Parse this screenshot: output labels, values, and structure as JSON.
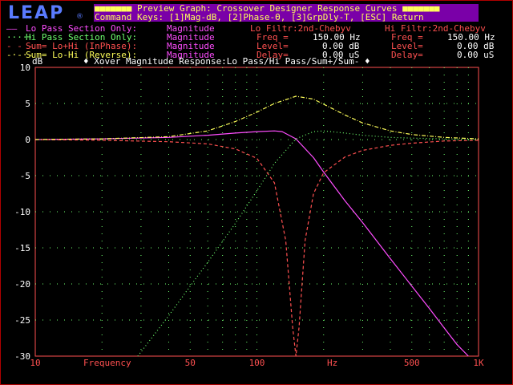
{
  "header": {
    "logo_text": "LEAP",
    "logo_mark": "®",
    "title": "■■■■■■■ Preview Graph: Crossover Designer Response Curves ■■■■■■■",
    "command_keys": "Command Keys: [1]Mag-dB, [2]Phase-Θ, [3]GrpDly-T, [ESC] Return"
  },
  "legend": [
    {
      "marker": "——",
      "label": "Lo Pass Section Only:",
      "value": "Magnitude",
      "color": "#ff4dff"
    },
    {
      "marker": "·····",
      "label": "Hi Pass Section Only:",
      "value": "Magnitude",
      "color": "#6fff6f"
    },
    {
      "marker": "- - -",
      "label": "Sum= Lo+Hi (InPhase):",
      "value": "Magnitude",
      "color": "#ff5050"
    },
    {
      "marker": "-·-·-",
      "label": "Sum= Lo-Hi (Reverse):",
      "value": "Magnitude",
      "color": "#ffff5a"
    }
  ],
  "filters": {
    "lo": {
      "title": "Lo Filtr:2nd-Chebyv",
      "freq_label": "Freq =",
      "freq": "150.00 Hz",
      "level_label": "Level=",
      "level": "0.00 dB",
      "delay_label": "Delay=",
      "delay": "0.00 uS"
    },
    "hi": {
      "title": "Hi Filtr:2nd-Chebyv",
      "freq_label": "Freq =",
      "freq": "150.00 Hz",
      "level_label": "Level=",
      "level": "0.00 dB",
      "delay_label": "Delay=",
      "delay": "0.00 uS"
    }
  },
  "chart_data": {
    "type": "line",
    "title": "♦ Xover Magnitude Response:Lo Pass/Hi Pass/Sum+/Sum- ♦",
    "ylabel": "dB",
    "xlabel": "Frequency",
    "xunit": "Hz",
    "xscale": "log",
    "xlim": [
      10,
      1000
    ],
    "ylim": [
      -30,
      10
    ],
    "x_ticks": [
      10,
      50,
      100,
      500,
      1000
    ],
    "x_tick_labels": [
      "10",
      "50",
      "100",
      "500",
      "1K"
    ],
    "y_ticks": [
      10,
      5,
      0,
      -5,
      -10,
      -15,
      -20,
      -25,
      -30
    ],
    "grid": true,
    "series": [
      {
        "name": "Lo Pass Section Only: Magnitude",
        "color": "#ff4dff",
        "style": "solid",
        "x": [
          10,
          20,
          40,
          60,
          80,
          100,
          120,
          130,
          150,
          180,
          200,
          250,
          300,
          400,
          500,
          600,
          700,
          800,
          900
        ],
        "y": [
          0,
          0.1,
          0.3,
          0.6,
          0.9,
          1.1,
          1.2,
          1.1,
          0.1,
          -2.5,
          -4.5,
          -8.5,
          -11.5,
          -16.5,
          -20.3,
          -23.4,
          -26.1,
          -28.4,
          -30
        ]
      },
      {
        "name": "Hi Pass Section Only: Magnitude",
        "color": "#6fff6f",
        "style": "dotted",
        "x": [
          29,
          40,
          50,
          60,
          80,
          100,
          120,
          150,
          180,
          200,
          250,
          300,
          400,
          500,
          700,
          1000
        ],
        "y": [
          -30,
          -24.4,
          -20.3,
          -17,
          -11.6,
          -7.1,
          -3.3,
          0.1,
          1.1,
          1.2,
          0.9,
          0.6,
          0.3,
          0.2,
          0.1,
          0
        ]
      },
      {
        "name": "Sum= Lo+Hi (InPhase): Magnitude",
        "color": "#ff5050",
        "style": "dashed",
        "x": [
          10,
          20,
          40,
          60,
          80,
          100,
          120,
          135,
          145,
          150,
          155,
          165,
          180,
          200,
          250,
          300,
          400,
          500,
          700,
          1000
        ],
        "y": [
          0,
          -0.1,
          -0.3,
          -0.6,
          -1.3,
          -2.6,
          -6,
          -14,
          -26,
          -30,
          -26,
          -14,
          -7.5,
          -4.6,
          -2.4,
          -1.5,
          -0.8,
          -0.5,
          -0.2,
          -0.1
        ]
      },
      {
        "name": "Sum= Lo-Hi (Reverse): Magnitude",
        "color": "#ffff5a",
        "style": "dashdot",
        "x": [
          10,
          20,
          40,
          60,
          80,
          100,
          120,
          150,
          180,
          200,
          250,
          300,
          400,
          500,
          700,
          1000
        ],
        "y": [
          0,
          0.1,
          0.4,
          1.2,
          2.5,
          3.8,
          5,
          6,
          5.6,
          4.9,
          3.4,
          2.3,
          1.2,
          0.7,
          0.3,
          0.1
        ]
      }
    ]
  }
}
